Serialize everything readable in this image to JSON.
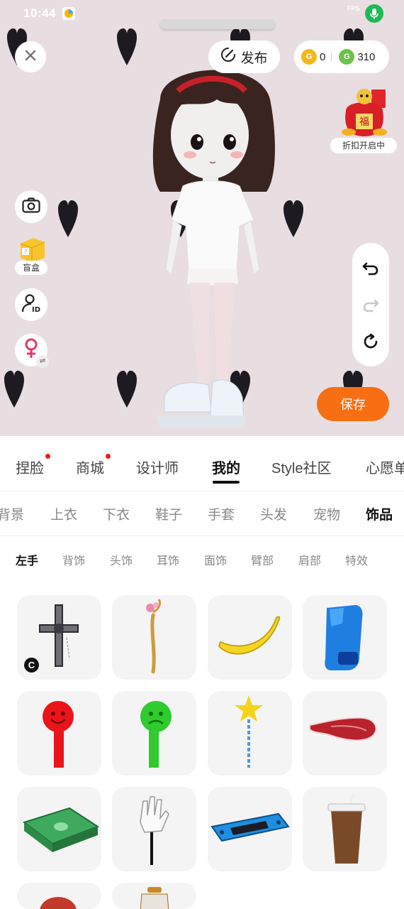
{
  "status_bar": {
    "time": "10:44",
    "fps_label": "FPS",
    "mic_icon": "mic-icon",
    "app_icon": "notification-app-icon"
  },
  "top": {
    "close_icon": "close-icon",
    "publish_label": "发布",
    "publish_icon": "publish-pencil-icon",
    "coin_gold_value": "0",
    "coin_green_value": "310",
    "coin_gold_icon": "gold-coin-icon",
    "coin_green_icon": "green-coin-icon"
  },
  "promo": {
    "label": "折扣开启中",
    "icon": "lucky-bag-icon"
  },
  "left_tools": {
    "camera_icon": "camera-icon",
    "blindbox_label": "盲盒",
    "blindbox_icon": "blind-box-icon",
    "profile_id_icon": "profile-id-icon",
    "gender_icon": "female-gender-icon",
    "gender_switch_icon": "swap-icon"
  },
  "history_tools": {
    "undo_icon": "undo-icon",
    "redo_icon": "redo-icon",
    "reset_icon": "reset-icon"
  },
  "save_label": "保存",
  "main_tabs": [
    {
      "label": "捏脸",
      "dot": true
    },
    {
      "label": "商城",
      "dot": true
    },
    {
      "label": "设计师",
      "dot": false
    },
    {
      "label": "我的",
      "dot": false,
      "active": true
    },
    {
      "label": "Style社区",
      "dot": false
    },
    {
      "label": "心愿单",
      "dot": false
    }
  ],
  "category_tabs": [
    {
      "label": "背景"
    },
    {
      "label": "上衣"
    },
    {
      "label": "下衣"
    },
    {
      "label": "鞋子"
    },
    {
      "label": "手套"
    },
    {
      "label": "头发"
    },
    {
      "label": "宠物"
    },
    {
      "label": "饰品",
      "active": true
    }
  ],
  "sub_tabs": [
    {
      "label": "左手",
      "active": true
    },
    {
      "label": "背饰"
    },
    {
      "label": "头饰"
    },
    {
      "label": "耳饰"
    },
    {
      "label": "面饰"
    },
    {
      "label": "臂部"
    },
    {
      "label": "肩部"
    },
    {
      "label": "特效"
    }
  ],
  "items": [
    {
      "icon": "gothic-cross-icon",
      "badge": "C"
    },
    {
      "icon": "flower-staff-icon"
    },
    {
      "icon": "banana-icon"
    },
    {
      "icon": "blue-boxing-glove-icon"
    },
    {
      "icon": "red-smiley-sign-icon"
    },
    {
      "icon": "green-sad-sign-icon"
    },
    {
      "icon": "star-wand-icon"
    },
    {
      "icon": "raw-steak-icon"
    },
    {
      "icon": "cash-stack-icon"
    },
    {
      "icon": "white-glove-stick-icon"
    },
    {
      "icon": "handheld-console-icon"
    },
    {
      "icon": "coffee-cup-icon"
    },
    {
      "icon": "red-ball-icon"
    },
    {
      "icon": "spray-bottle-icon"
    }
  ]
}
